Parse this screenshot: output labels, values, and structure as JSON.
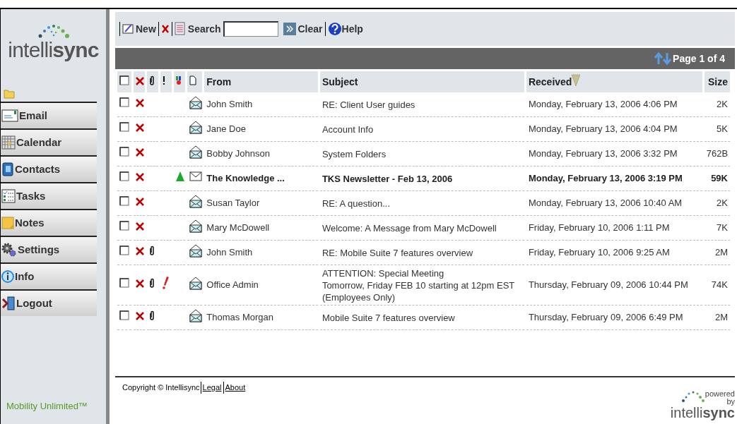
{
  "logo": {
    "text": "intelli**sync**"
  },
  "sidebar": {
    "items": [
      {
        "kind": "email",
        "label": "Email"
      },
      {
        "kind": "calendar",
        "label": "Calendar"
      },
      {
        "kind": "contacts",
        "label": "Contacts"
      },
      {
        "kind": "tasks",
        "label": "Tasks"
      },
      {
        "kind": "notes",
        "label": "Notes"
      },
      {
        "kind": "settings",
        "label": "Settings"
      },
      {
        "kind": "info",
        "label": "Info"
      },
      {
        "kind": "logout",
        "label": "Logout"
      }
    ],
    "tagline": "Mobility Unlimited™"
  },
  "toolbar": {
    "new": "New",
    "search": "Search",
    "clear": "Clear",
    "help": "Help"
  },
  "pager": {
    "label": "Page 1 of 4"
  },
  "table": {
    "select_all_checked": false,
    "columns": [
      "From",
      "Subject",
      "Received",
      "Size"
    ],
    "rows": [
      {
        "from": "John Smith",
        "subject": [
          "RE: Client User guides"
        ],
        "received": "Monday, February 13, 2006 4:06 PM",
        "size": "2K",
        "read": true,
        "attachment": false,
        "high_priority": false,
        "flagged": false,
        "checked": false
      },
      {
        "from": "Jane Doe",
        "subject": [
          "Account Info"
        ],
        "received": "Monday, February 13, 2006 4:04 PM",
        "size": "5K",
        "read": true,
        "attachment": false,
        "high_priority": false,
        "flagged": false,
        "checked": false
      },
      {
        "from": "Bobby Johnson",
        "subject": [
          "System Folders"
        ],
        "received": "Monday, February 13, 2006 3:32 PM",
        "size": "762B",
        "read": true,
        "attachment": false,
        "high_priority": false,
        "flagged": false,
        "checked": false
      },
      {
        "from": "The Knowledge ...",
        "subject": [
          "TKS Newsletter - Feb 13, 2006"
        ],
        "received": "Monday, February 13, 2006 3:19 PM",
        "size": "59K",
        "read": false,
        "attachment": false,
        "high_priority": false,
        "flagged": true,
        "checked": false
      },
      {
        "from": "Susan Taylor",
        "subject": [
          "RE: A question..."
        ],
        "received": "Monday, February 13, 2006 10:40 AM",
        "size": "2K",
        "read": true,
        "attachment": false,
        "high_priority": false,
        "flagged": false,
        "checked": false
      },
      {
        "from": "Mary McDowell",
        "subject": [
          "Welcome: A Message from Mary McDowell"
        ],
        "received": "Friday, February 10, 2006 1:11 PM",
        "size": "7K",
        "read": true,
        "attachment": false,
        "high_priority": false,
        "flagged": false,
        "checked": false
      },
      {
        "from": "John Smith",
        "subject": [
          "RE: Mobile Suite 7 features overview"
        ],
        "received": "Friday, February 10, 2006 9:25 AM",
        "size": "2M",
        "read": true,
        "attachment": true,
        "high_priority": false,
        "flagged": false,
        "checked": false
      },
      {
        "from": "Office Admin",
        "subject": [
          "ATTENTION: Special Meeting",
          "Tomorrow, Friday FEB 10 starting at 12pm EST",
          "(Employees Only)"
        ],
        "received": "Thursday, February 09, 2006 10:44 PM",
        "size": "74K",
        "read": true,
        "attachment": true,
        "high_priority": true,
        "flagged": false,
        "checked": false
      },
      {
        "from": "Thomas Morgan",
        "subject": [
          "Mobile Suite 7 features overview"
        ],
        "received": "Thursday, February 09, 2006 6:49 PM",
        "size": "2M",
        "read": true,
        "attachment": true,
        "high_priority": false,
        "flagged": false,
        "checked": false
      }
    ]
  },
  "footer": {
    "copyright": "Copyright © Intellisync",
    "links": [
      "Legal",
      "About"
    ],
    "powered": [
      "powered",
      "by"
    ],
    "logo": "intelli**sync**"
  }
}
